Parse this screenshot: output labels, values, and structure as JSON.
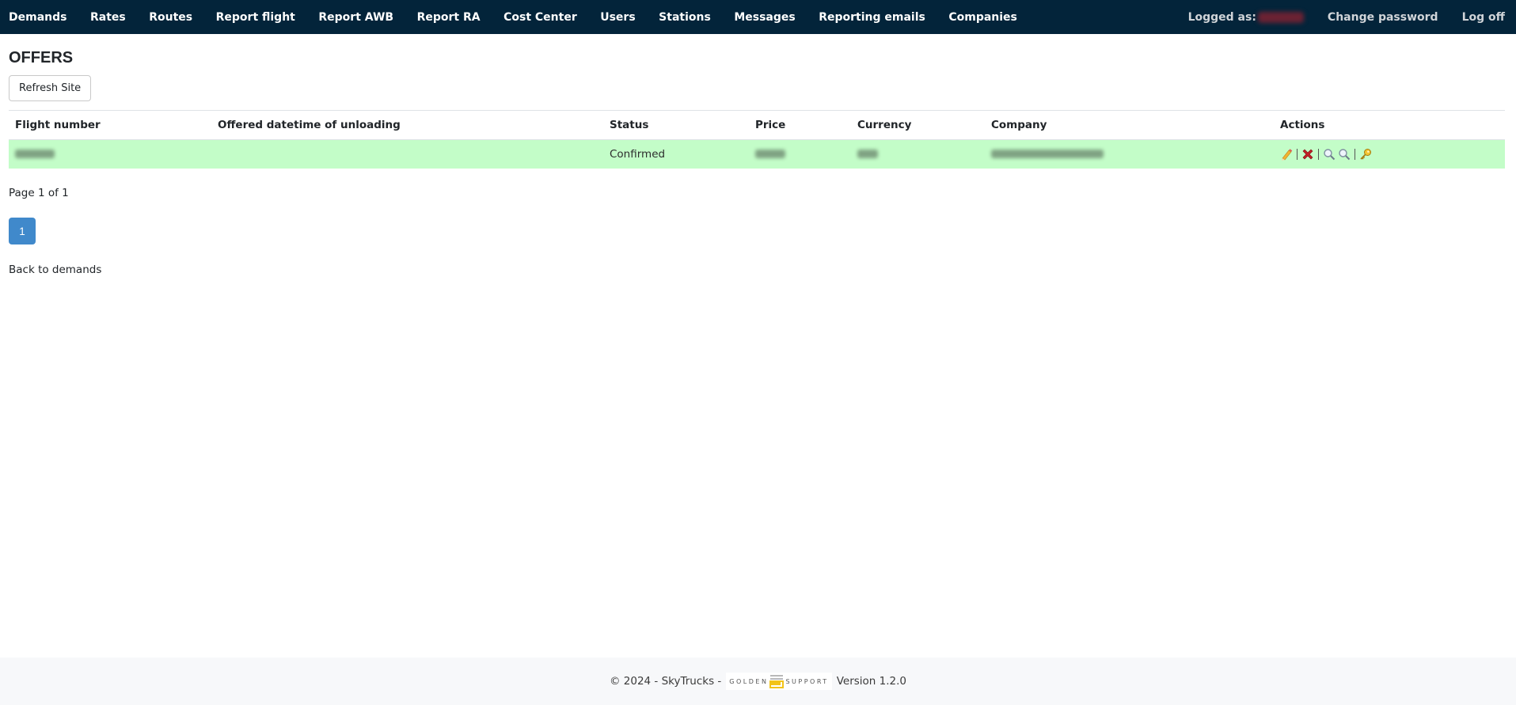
{
  "nav": {
    "items": [
      {
        "label": "Demands"
      },
      {
        "label": "Rates"
      },
      {
        "label": "Routes"
      },
      {
        "label": "Report flight"
      },
      {
        "label": "Report AWB"
      },
      {
        "label": "Report RA"
      },
      {
        "label": "Cost Center"
      },
      {
        "label": "Users"
      },
      {
        "label": "Stations"
      },
      {
        "label": "Messages"
      },
      {
        "label": "Reporting emails"
      },
      {
        "label": "Companies"
      }
    ],
    "logged_as_label": "Logged as:",
    "logged_user": "[redacted]",
    "change_password": "Change password",
    "log_off": "Log off"
  },
  "page": {
    "title": "OFFERS",
    "refresh_label": "Refresh Site"
  },
  "table": {
    "columns": [
      "Flight number",
      "Offered datetime of unloading",
      "Status",
      "Price",
      "Currency",
      "Company",
      "Actions"
    ],
    "rows": [
      {
        "flight_number": "[blurred]",
        "offered_datetime": "",
        "status": "Confirmed",
        "price": "[blurred]",
        "currency": "[blurred]",
        "company": "[blurred]",
        "actions": [
          "edit-icon",
          "delete-icon",
          "view-icon",
          "details-icon",
          "key-icon"
        ]
      }
    ],
    "row_color": "#c3fdc8"
  },
  "pagination": {
    "info": "Page 1 of 1",
    "current": "1"
  },
  "back_link": "Back to demands",
  "footer": {
    "copyright": "© 2024 - SkyTrucks -",
    "logo_left": "GOLDEN",
    "logo_right": "SUPPORT",
    "version": "Version 1.2.0"
  },
  "colors": {
    "navbar": "#03243a",
    "page_button": "#4089cb",
    "confirmed_row": "#c3fdc8"
  }
}
